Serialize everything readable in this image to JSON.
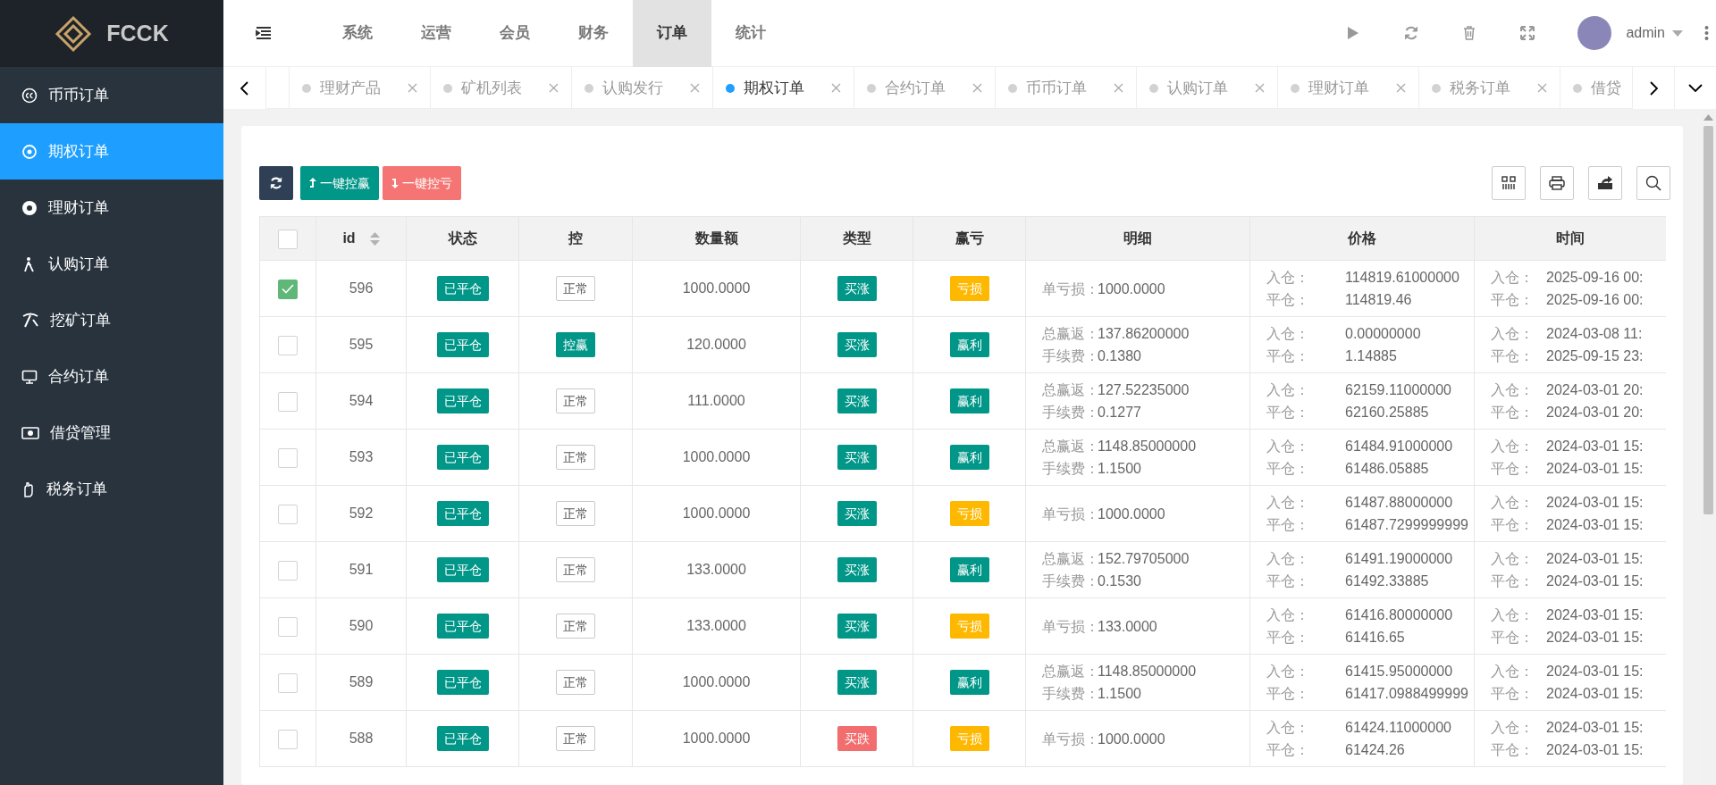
{
  "sidebar": {
    "logo": "FCCK",
    "items": [
      {
        "label": "币币订单",
        "selected": false
      },
      {
        "label": "期权订单",
        "selected": true
      },
      {
        "label": "理财订单",
        "selected": false
      },
      {
        "label": "认购订单",
        "selected": false
      },
      {
        "label": "挖矿订单",
        "selected": false
      },
      {
        "label": "合约订单",
        "selected": false
      },
      {
        "label": "借贷管理",
        "selected": false
      },
      {
        "label": "税务订单",
        "selected": false
      }
    ]
  },
  "top_nav": {
    "items": [
      {
        "label": "系统",
        "selected": false
      },
      {
        "label": "运营",
        "selected": false
      },
      {
        "label": "会员",
        "selected": false
      },
      {
        "label": "财务",
        "selected": false
      },
      {
        "label": "订单",
        "selected": true
      },
      {
        "label": "统计",
        "selected": false
      }
    ],
    "user": "admin"
  },
  "tabs": [
    {
      "label": "理财产品",
      "selected": false
    },
    {
      "label": "矿机列表",
      "selected": false
    },
    {
      "label": "认购发行",
      "selected": false
    },
    {
      "label": "期权订单",
      "selected": true
    },
    {
      "label": "合约订单",
      "selected": false
    },
    {
      "label": "币币订单",
      "selected": false
    },
    {
      "label": "认购订单",
      "selected": false
    },
    {
      "label": "理财订单",
      "selected": false
    },
    {
      "label": "税务订单",
      "selected": false
    },
    {
      "label": "借贷",
      "selected": false
    }
  ],
  "toolbar": {
    "buttons": [
      {
        "label": "一键控赢",
        "kind": "win"
      },
      {
        "label": "一键控亏",
        "kind": "lose"
      }
    ]
  },
  "table": {
    "select_all_checked": false,
    "columns": [
      "id",
      "状态",
      "控",
      "数量额",
      "类型",
      "赢亏",
      "明细",
      "价格",
      "时间"
    ],
    "rows": [
      {
        "checked": true,
        "id": "596",
        "status": "已平仓",
        "control": {
          "text": "正常",
          "kind": "outline"
        },
        "amount": "1000.0000",
        "type": {
          "text": "买涨",
          "color": "#009688"
        },
        "pnl": {
          "text": "亏损",
          "color": "#ffb800"
        },
        "detail": [
          {
            "label": "单亏损：",
            "value": "1000.0000"
          }
        ],
        "price": [
          {
            "label": "入仓：",
            "value": "114819.61000000"
          },
          {
            "label": "平仓：",
            "value": "114819.46"
          }
        ],
        "time": [
          {
            "label": "入仓：",
            "value": "2025-09-16 00:"
          },
          {
            "label": "平仓：",
            "value": "2025-09-16 00:"
          }
        ]
      },
      {
        "checked": false,
        "id": "595",
        "status": "已平仓",
        "control": {
          "text": "控赢",
          "kind": "filled"
        },
        "amount": "120.0000",
        "type": {
          "text": "买涨",
          "color": "#009688"
        },
        "pnl": {
          "text": "赢利",
          "color": "#009688"
        },
        "detail": [
          {
            "label": "总赢返：",
            "value": "137.86200000"
          },
          {
            "label": "手续费：",
            "value": "0.1380"
          }
        ],
        "price": [
          {
            "label": "入仓：",
            "value": "0.00000000"
          },
          {
            "label": "平仓：",
            "value": "1.14885"
          }
        ],
        "time": [
          {
            "label": "入仓：",
            "value": "2024-03-08 11:"
          },
          {
            "label": "平仓：",
            "value": "2025-09-15 23:"
          }
        ]
      },
      {
        "checked": false,
        "id": "594",
        "status": "已平仓",
        "control": {
          "text": "正常",
          "kind": "outline"
        },
        "amount": "111.0000",
        "type": {
          "text": "买涨",
          "color": "#009688"
        },
        "pnl": {
          "text": "赢利",
          "color": "#009688"
        },
        "detail": [
          {
            "label": "总赢返：",
            "value": "127.52235000"
          },
          {
            "label": "手续费：",
            "value": "0.1277"
          }
        ],
        "price": [
          {
            "label": "入仓：",
            "value": "62159.11000000"
          },
          {
            "label": "平仓：",
            "value": "62160.25885"
          }
        ],
        "time": [
          {
            "label": "入仓：",
            "value": "2024-03-01 20:"
          },
          {
            "label": "平仓：",
            "value": "2024-03-01 20:"
          }
        ]
      },
      {
        "checked": false,
        "id": "593",
        "status": "已平仓",
        "control": {
          "text": "正常",
          "kind": "outline"
        },
        "amount": "1000.0000",
        "type": {
          "text": "买涨",
          "color": "#009688"
        },
        "pnl": {
          "text": "赢利",
          "color": "#009688"
        },
        "detail": [
          {
            "label": "总赢返：",
            "value": "1148.85000000"
          },
          {
            "label": "手续费：",
            "value": "1.1500"
          }
        ],
        "price": [
          {
            "label": "入仓：",
            "value": "61484.91000000"
          },
          {
            "label": "平仓：",
            "value": "61486.05885"
          }
        ],
        "time": [
          {
            "label": "入仓：",
            "value": "2024-03-01 15:"
          },
          {
            "label": "平仓：",
            "value": "2024-03-01 15:"
          }
        ]
      },
      {
        "checked": false,
        "id": "592",
        "status": "已平仓",
        "control": {
          "text": "正常",
          "kind": "outline"
        },
        "amount": "1000.0000",
        "type": {
          "text": "买涨",
          "color": "#009688"
        },
        "pnl": {
          "text": "亏损",
          "color": "#ffb800"
        },
        "detail": [
          {
            "label": "单亏损：",
            "value": "1000.0000"
          }
        ],
        "price": [
          {
            "label": "入仓：",
            "value": "61487.88000000"
          },
          {
            "label": "平仓：",
            "value": "61487.7299999999"
          }
        ],
        "time": [
          {
            "label": "入仓：",
            "value": "2024-03-01 15:"
          },
          {
            "label": "平仓：",
            "value": "2024-03-01 15:"
          }
        ]
      },
      {
        "checked": false,
        "id": "591",
        "status": "已平仓",
        "control": {
          "text": "正常",
          "kind": "outline"
        },
        "amount": "133.0000",
        "type": {
          "text": "买涨",
          "color": "#009688"
        },
        "pnl": {
          "text": "赢利",
          "color": "#009688"
        },
        "detail": [
          {
            "label": "总赢返：",
            "value": "152.79705000"
          },
          {
            "label": "手续费：",
            "value": "0.1530"
          }
        ],
        "price": [
          {
            "label": "入仓：",
            "value": "61491.19000000"
          },
          {
            "label": "平仓：",
            "value": "61492.33885"
          }
        ],
        "time": [
          {
            "label": "入仓：",
            "value": "2024-03-01 15:"
          },
          {
            "label": "平仓：",
            "value": "2024-03-01 15:"
          }
        ]
      },
      {
        "checked": false,
        "id": "590",
        "status": "已平仓",
        "control": {
          "text": "正常",
          "kind": "outline"
        },
        "amount": "133.0000",
        "type": {
          "text": "买涨",
          "color": "#009688"
        },
        "pnl": {
          "text": "亏损",
          "color": "#ffb800"
        },
        "detail": [
          {
            "label": "单亏损：",
            "value": "133.0000"
          }
        ],
        "price": [
          {
            "label": "入仓：",
            "value": "61416.80000000"
          },
          {
            "label": "平仓：",
            "value": "61416.65"
          }
        ],
        "time": [
          {
            "label": "入仓：",
            "value": "2024-03-01 15:"
          },
          {
            "label": "平仓：",
            "value": "2024-03-01 15:"
          }
        ]
      },
      {
        "checked": false,
        "id": "589",
        "status": "已平仓",
        "control": {
          "text": "正常",
          "kind": "outline"
        },
        "amount": "1000.0000",
        "type": {
          "text": "买涨",
          "color": "#009688"
        },
        "pnl": {
          "text": "赢利",
          "color": "#009688"
        },
        "detail": [
          {
            "label": "总赢返：",
            "value": "1148.85000000"
          },
          {
            "label": "手续费：",
            "value": "1.1500"
          }
        ],
        "price": [
          {
            "label": "入仓：",
            "value": "61415.95000000"
          },
          {
            "label": "平仓：",
            "value": "61417.0988499999"
          }
        ],
        "time": [
          {
            "label": "入仓：",
            "value": "2024-03-01 15:"
          },
          {
            "label": "平仓：",
            "value": "2024-03-01 15:"
          }
        ]
      },
      {
        "checked": false,
        "id": "588",
        "status": "已平仓",
        "control": {
          "text": "正常",
          "kind": "outline"
        },
        "amount": "1000.0000",
        "type": {
          "text": "买跌",
          "color": "#f26e6e"
        },
        "pnl": {
          "text": "亏损",
          "color": "#ffb800"
        },
        "detail": [
          {
            "label": "单亏损：",
            "value": "1000.0000"
          }
        ],
        "price": [
          {
            "label": "入仓：",
            "value": "61424.11000000"
          },
          {
            "label": "平仓：",
            "value": "61424.26"
          }
        ],
        "time": [
          {
            "label": "入仓：",
            "value": "2024-03-01 15:"
          },
          {
            "label": "平仓：",
            "value": "2024-03-01 15:"
          }
        ]
      }
    ]
  }
}
